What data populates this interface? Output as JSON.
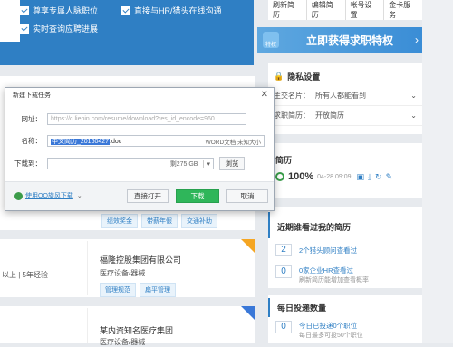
{
  "banner": {
    "features": [
      "尊享专属人脉职位",
      "直接与HR/猎头在线沟通",
      "实时查询应聘进展"
    ]
  },
  "right_links": [
    "刷新简历",
    "编辑简历",
    "帐号设置",
    "金卡服务"
  ],
  "upgrade": {
    "badge": "特权",
    "title": "立即获得求职特权",
    "arrow": "›"
  },
  "privacy": {
    "title": "隐私设置",
    "rows": [
      {
        "label": "主交名片：",
        "value": "所有人都能看到"
      },
      {
        "label": "求职简历：",
        "value": "开放简历"
      }
    ]
  },
  "resume": {
    "title": "简历",
    "percent": "100%",
    "date": "04-28 09:09"
  },
  "recent": {
    "title": "近期谁看过我的简历",
    "items": [
      {
        "count": "2",
        "text": "2个猎头顾问查看过"
      },
      {
        "count": "0",
        "text": "0家企业HR查看过",
        "sub": "刷新简历能增加查看概率"
      }
    ]
  },
  "daily": {
    "title": "每日投递数量",
    "count": "0",
    "text": "今日已投递0个职位",
    "sub": "每日最多可投50个职位"
  },
  "cards": [
    {
      "tags": [
        "绩效奖金",
        "带薪年假",
        "交通补助"
      ]
    },
    {
      "left_text": "以上 | 5年经验",
      "company": "福隆控股集团有限公司",
      "industry": "医疗设备/器械",
      "tags": [
        "管理规范",
        "扁平管理"
      ]
    },
    {
      "company": "某内资知名医疗集团",
      "industry": "医疗设备/器械"
    }
  ],
  "dialog": {
    "title": "新建下载任务",
    "close": "✕",
    "url_label": "网址：",
    "url_value": "https://c.liepin.com/resume/download?res_id_encode=960",
    "name_label": "名称：",
    "name_selected": "中文简历_20160427",
    "name_ext": ".doc",
    "name_meta": "WORD文档 未知大小",
    "path_label": "下载到：",
    "path_free": "剩275 GB",
    "browse": "浏览",
    "qq_link": "使用QQ旋风下载",
    "open_direct": "直接打开",
    "download": "下载",
    "cancel": "取消"
  }
}
